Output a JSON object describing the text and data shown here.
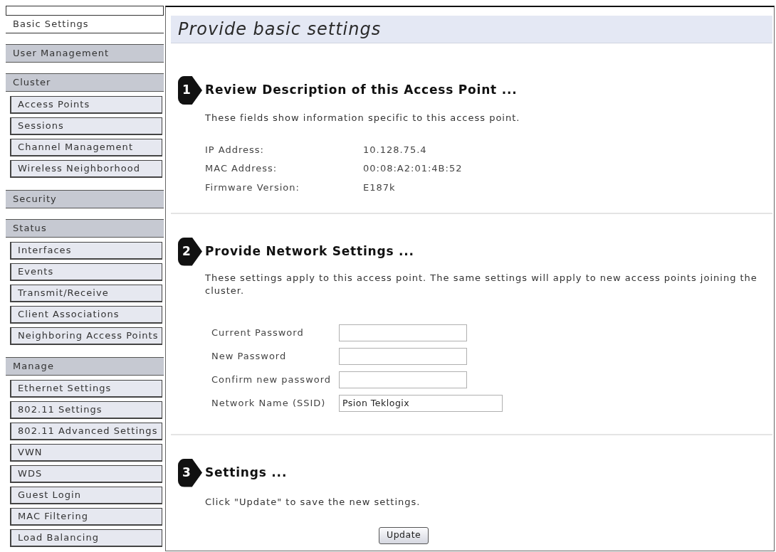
{
  "sidebar": {
    "items": [
      {
        "label": "Basic Settings",
        "selected": true
      },
      {
        "label": "User Management",
        "selected": false
      },
      {
        "label": "Cluster",
        "selected": false,
        "children": [
          {
            "label": "Access Points",
            "selected": false
          },
          {
            "label": "Sessions",
            "selected": false
          },
          {
            "label": "Channel Management",
            "selected": false
          },
          {
            "label": "Wireless Neighborhood",
            "selected": false
          }
        ]
      },
      {
        "label": "Security",
        "selected": false
      },
      {
        "label": "Status",
        "selected": false,
        "children": [
          {
            "label": "Interfaces",
            "selected": false
          },
          {
            "label": "Events",
            "selected": false
          },
          {
            "label": "Transmit/Receive",
            "selected": false
          },
          {
            "label": "Client Associations",
            "selected": false
          },
          {
            "label": "Neighboring Access Points",
            "selected": false
          }
        ]
      },
      {
        "label": "Manage",
        "selected": false,
        "children": [
          {
            "label": "Ethernet Settings",
            "selected": false
          },
          {
            "label": "802.11 Settings",
            "selected": false
          },
          {
            "label": "802.11 Advanced Settings",
            "selected": false
          },
          {
            "label": "VWN",
            "selected": false
          },
          {
            "label": "WDS",
            "selected": false
          },
          {
            "label": "Guest Login",
            "selected": false
          },
          {
            "label": "MAC Filtering",
            "selected": false
          },
          {
            "label": "Load Balancing",
            "selected": false
          }
        ]
      }
    ]
  },
  "page_title": "Provide basic settings",
  "sections": [
    {
      "kind": "info",
      "number": "1",
      "heading": "Review Description of this Access Point ...",
      "description": "These fields show information specific to this access point.",
      "fields": [
        {
          "label": "IP Address:",
          "value": "10.128.75.4"
        },
        {
          "label": "MAC Address:",
          "value": "00:08:A2:01:4B:52"
        },
        {
          "label": "Firmware Version:",
          "value": "E187k"
        }
      ]
    },
    {
      "kind": "form",
      "number": "2",
      "heading": "Provide Network Settings ...",
      "description": "These settings apply to this access point. The same settings will apply to new access points joining the cluster.",
      "fields": [
        {
          "kind": "password",
          "label": "Current Password"
        },
        {
          "kind": "password",
          "label": "New Password"
        },
        {
          "kind": "password",
          "label": "Confirm new password"
        },
        {
          "kind": "text",
          "label": "Network Name (SSID)",
          "value": "Psion Teklogix"
        }
      ]
    },
    {
      "kind": "action",
      "number": "3",
      "heading": "Settings ...",
      "description": "Click \"Update\" to save the new settings.",
      "button": "Update"
    }
  ]
}
